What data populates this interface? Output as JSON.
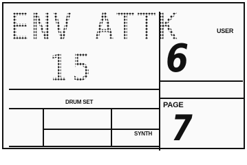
{
  "display": {
    "parameter_name": "ENV ATTK",
    "parameter_value": "15",
    "user_label": "USER",
    "user_number": "6",
    "page_label": "PAGE",
    "page_number": "7",
    "drum_set_label": "DRUM SET",
    "synth_label": "SYNTH"
  }
}
